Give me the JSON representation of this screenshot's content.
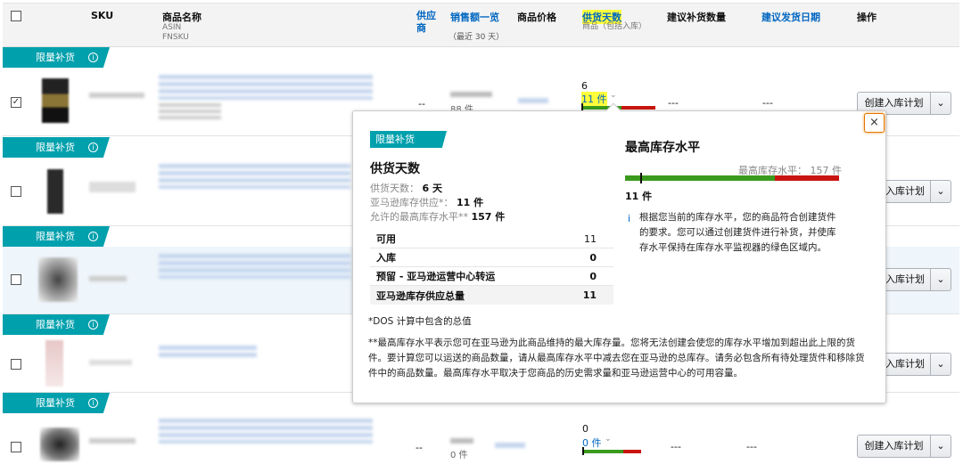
{
  "header": {
    "sku": "SKU",
    "name": "商品名称",
    "name_sub1": "ASIN",
    "name_sub2": "FNSKU",
    "supplier": "供应商",
    "sales": "销售额一览",
    "sales_sub": "（最近 30 天）",
    "price": "商品价格",
    "dos": "供货天数",
    "dos_sub": "商品（包括入库）",
    "suggest_qty": "建议补货数量",
    "ship_date": "建议发货日期",
    "action": "操作"
  },
  "banner_label": "限量补货",
  "rows": [
    {
      "checked": true,
      "supplier": "--",
      "sales_units": "88 件",
      "dos_days": "6",
      "dos_units": "11 件",
      "suggest_qty": "---",
      "ship_date": "---",
      "button": "创建入库计划"
    },
    {
      "checked": false,
      "button": "入库计划"
    },
    {
      "checked": false,
      "button": "入库计划"
    },
    {
      "checked": false,
      "button": "入库计划"
    },
    {
      "checked": false,
      "supplier": "--",
      "sales_units": "0 件",
      "dos_days": "0",
      "dos_units": "0 件",
      "suggest_qty": "---",
      "ship_date": "---",
      "button": "创建入库计划"
    }
  ],
  "popup": {
    "tag": "限量补货",
    "dos_title": "供货天数",
    "dos_label": "供货天数：",
    "dos_value": "6 天",
    "supply_label": "亚马逊库存供应*：",
    "supply_value": "11 件",
    "max_label": "允许的最高库存水平**",
    "max_value": "157 件",
    "table": [
      {
        "label": "可用",
        "value": "11"
      },
      {
        "label": "入库",
        "value": "0"
      },
      {
        "label": "预留 - 亚马逊运营中心转运",
        "value": "0"
      },
      {
        "label": "亚马逊库存供应总量",
        "value": "11"
      }
    ],
    "level_title": "最高库存水平",
    "level_max_label": "最高库存水平：",
    "level_max_value": "157 件",
    "level_current": "11 件",
    "level_fraction": 0.07,
    "info_icon": "i",
    "info_text": "根据您当前的库存水平，您的商品符合创建货件的要求。您可以通过创建货件进行补货，并使库存水平保持在库存水平监视器的绿色区域内。",
    "footnote1": "*DOS 计算中包含的总值",
    "footnote2": "**最高库存水平表示您可在亚马逊为此商品维持的最大库存量。您将无法创建会使您的库存水平增加到超出此上限的货件。要计算您可以运送的商品数量，请从最高库存水平中减去您在亚马逊的总库存。请务必包含所有待处理货件和移除货件中的商品数量。最高库存水平取决于您商品的历史需求量和亚马逊运营中心的可用容量。",
    "close": "×"
  },
  "colors": {
    "banner": "#00a0ad",
    "link": "#0066c0",
    "green": "#3a9a1d",
    "red": "#c8150f",
    "highlight": "#ffff3c"
  }
}
